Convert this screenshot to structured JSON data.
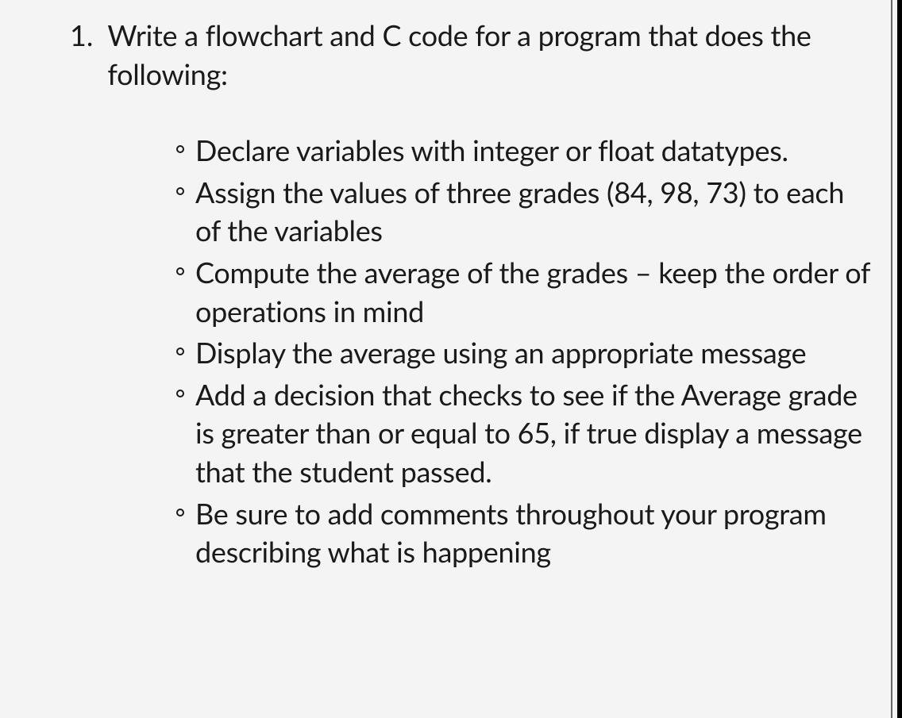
{
  "list": {
    "marker": "1.",
    "intro": "Write a flowchart and C code for a program that does the following:",
    "items": [
      "Declare variables with integer or float datatypes.",
      "Assign the values of three grades (84, 98, 73) to each of the variables",
      "Compute the average of the grades – keep the order of operations in mind",
      "Display the average using an appropriate message",
      "Add a decision that checks to see if the Average grade is greater than or equal to 65, if true display a message that the student passed.",
      "Be sure to add comments throughout your program describing what is happening"
    ]
  }
}
